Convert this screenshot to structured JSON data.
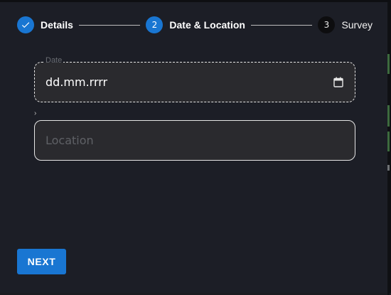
{
  "stepper": {
    "steps": [
      {
        "label": "Details",
        "number": "",
        "state": "completed"
      },
      {
        "label": "Date & Location",
        "number": "2",
        "state": "active"
      },
      {
        "label": "Survey",
        "number": "3",
        "state": "pending"
      }
    ]
  },
  "form": {
    "date": {
      "label": "Date",
      "value": "dd.mm.rrrr",
      "icon": "calendar-icon"
    },
    "location": {
      "placeholder": "Location"
    }
  },
  "actions": {
    "next_label": "NEXT"
  },
  "colors": {
    "accent": "#1976d2",
    "background": "#1c1e26",
    "field_background": "#2a2a2e"
  }
}
